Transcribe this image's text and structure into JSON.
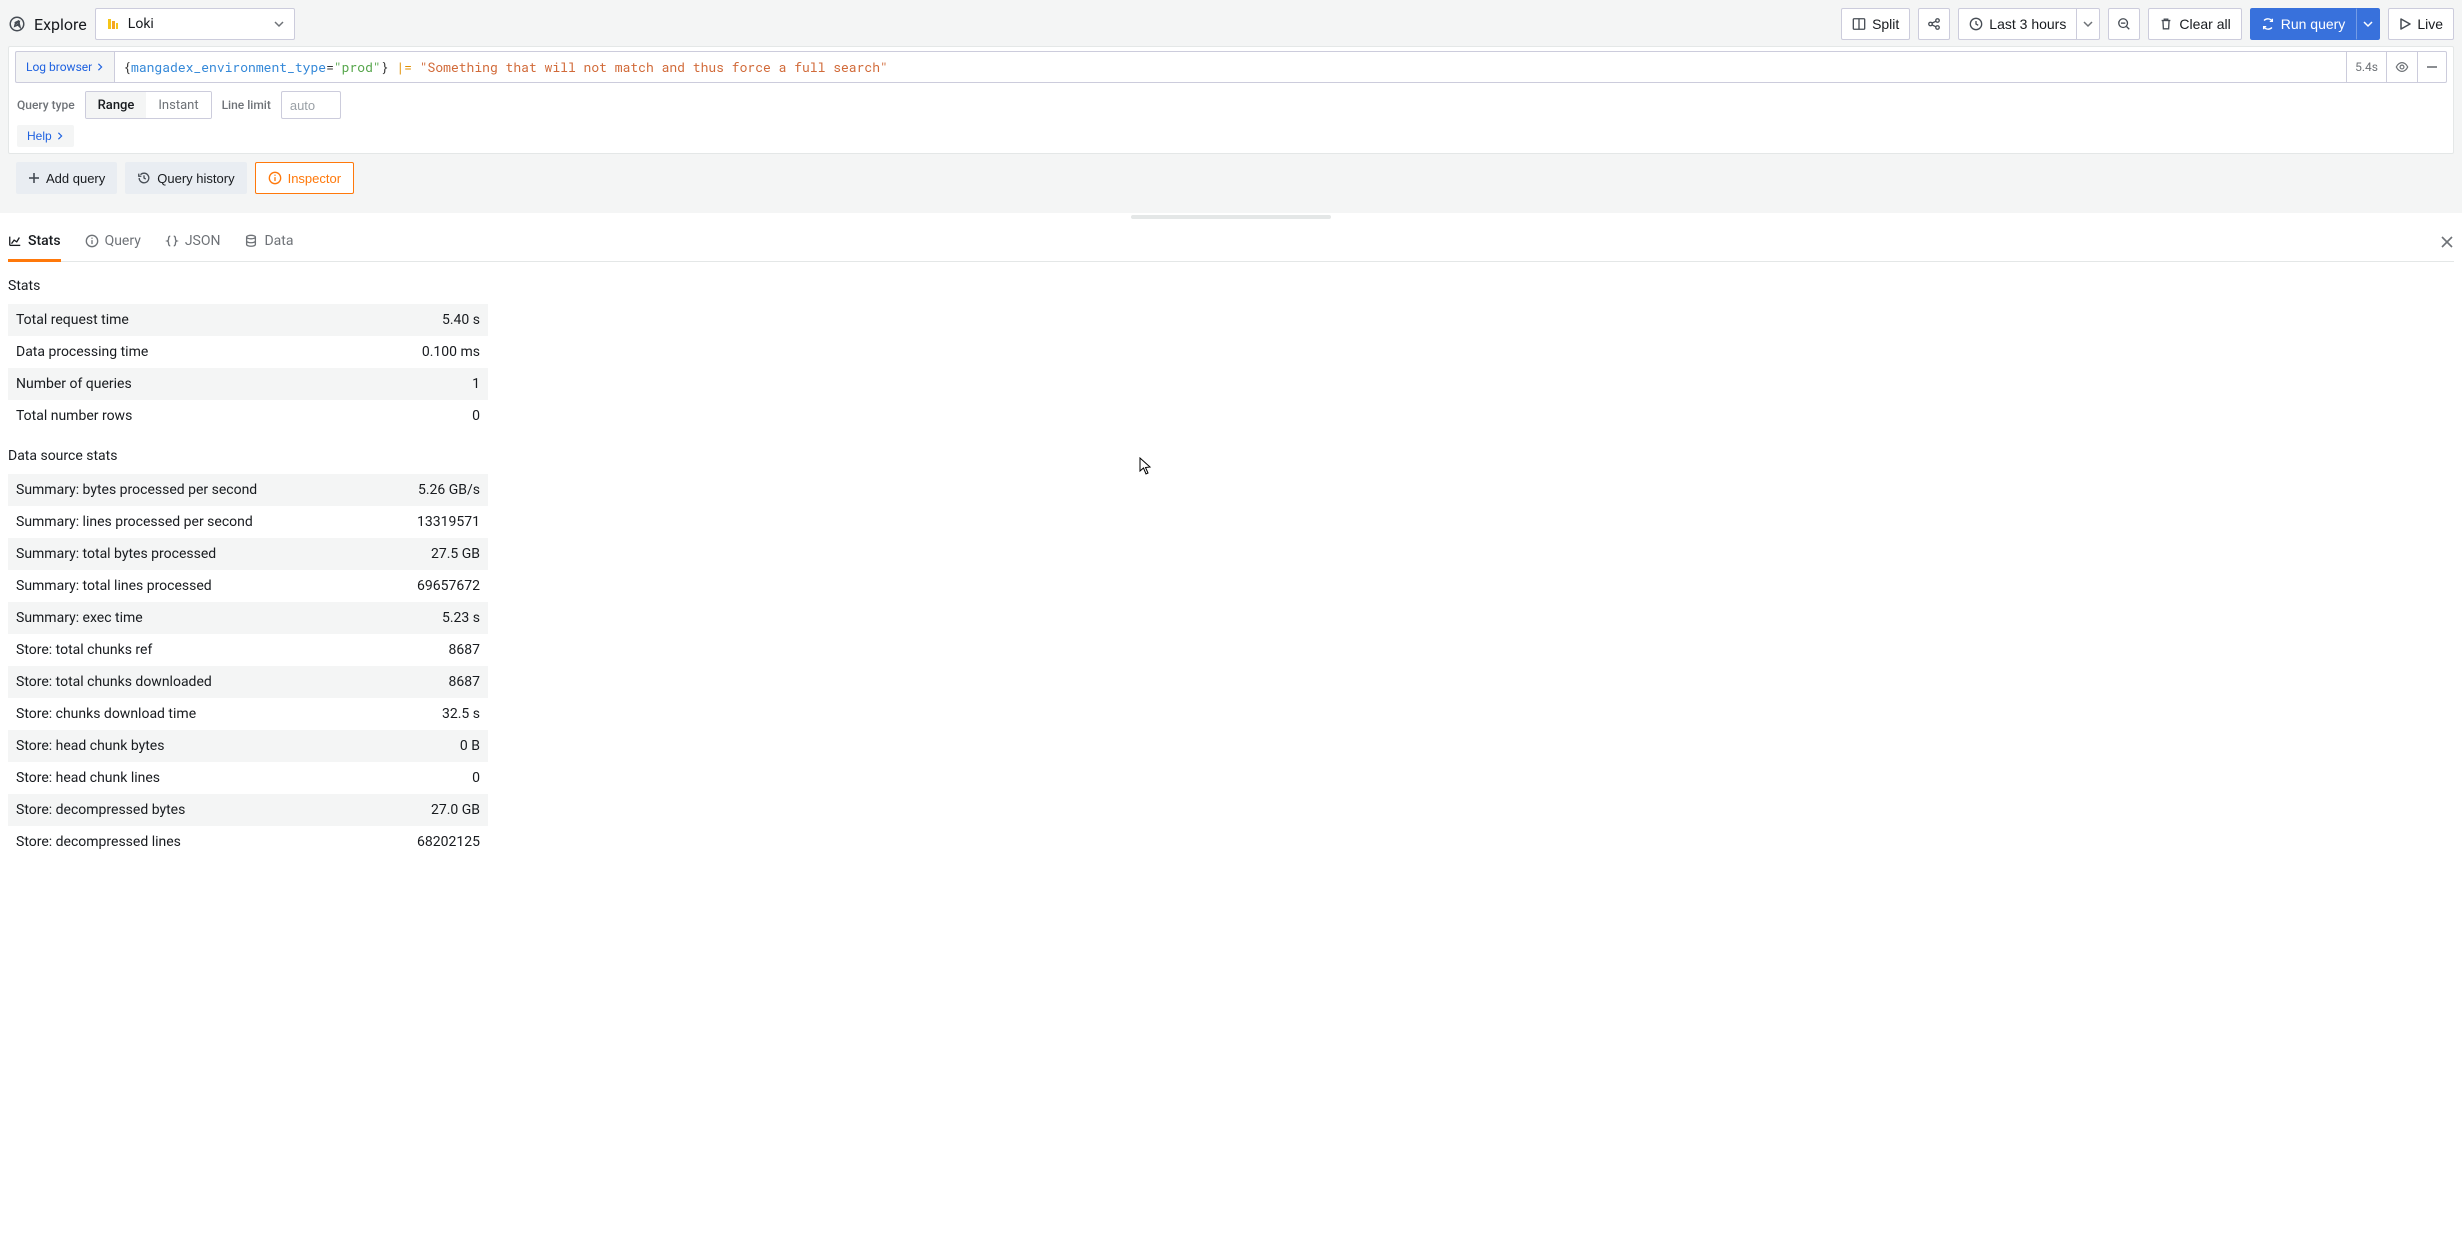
{
  "header": {
    "title": "Explore",
    "datasource": "Loki",
    "split": "Split",
    "time_range": "Last 3 hours",
    "clear_all": "Clear all",
    "run_query": "Run query",
    "live": "Live"
  },
  "query": {
    "log_browser": "Log browser",
    "code": {
      "label": "mangadex_environment_type",
      "value": "\"prod\"",
      "pipe": "|=",
      "match": "\"Something that will not match and thus force a full search\""
    },
    "exec_time": "5.4s",
    "options": {
      "query_type_label": "Query type",
      "range": "Range",
      "instant": "Instant",
      "line_limit_label": "Line limit",
      "line_limit_placeholder": "auto"
    },
    "help": "Help"
  },
  "actions": {
    "add_query": "Add query",
    "query_history": "Query history",
    "inspector": "Inspector"
  },
  "inspector": {
    "tabs": {
      "stats": "Stats",
      "query": "Query",
      "json": "JSON",
      "data": "Data"
    },
    "stats_heading": "Stats",
    "ds_stats_heading": "Data source stats",
    "stats": [
      {
        "label": "Total request time",
        "value": "5.40 s"
      },
      {
        "label": "Data processing time",
        "value": "0.100 ms"
      },
      {
        "label": "Number of queries",
        "value": "1"
      },
      {
        "label": "Total number rows",
        "value": "0"
      }
    ],
    "ds_stats": [
      {
        "label": "Summary: bytes processed per second",
        "value": "5.26 GB/s"
      },
      {
        "label": "Summary: lines processed per second",
        "value": "13319571"
      },
      {
        "label": "Summary: total bytes processed",
        "value": "27.5 GB"
      },
      {
        "label": "Summary: total lines processed",
        "value": "69657672"
      },
      {
        "label": "Summary: exec time",
        "value": "5.23 s"
      },
      {
        "label": "Store: total chunks ref",
        "value": "8687"
      },
      {
        "label": "Store: total chunks downloaded",
        "value": "8687"
      },
      {
        "label": "Store: chunks download time",
        "value": "32.5 s"
      },
      {
        "label": "Store: head chunk bytes",
        "value": "0 B"
      },
      {
        "label": "Store: head chunk lines",
        "value": "0"
      },
      {
        "label": "Store: decompressed bytes",
        "value": "27.0 GB"
      },
      {
        "label": "Store: decompressed lines",
        "value": "68202125"
      }
    ]
  }
}
